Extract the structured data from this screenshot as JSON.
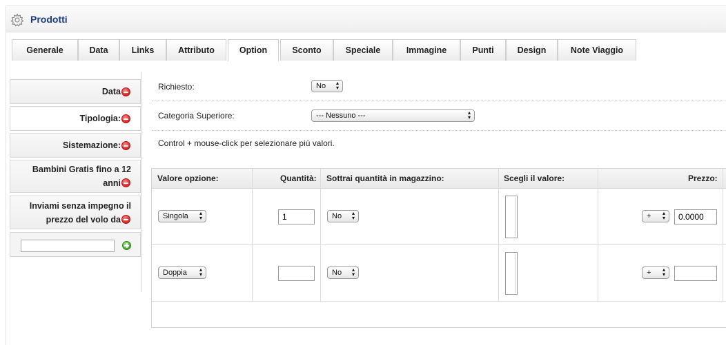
{
  "header": {
    "title": "Prodotti",
    "icon": "gear-icon"
  },
  "tabs": [
    {
      "label": "Generale"
    },
    {
      "label": "Data"
    },
    {
      "label": "Links"
    },
    {
      "label": "Attributo"
    },
    {
      "label": "Option"
    },
    {
      "label": "Sconto"
    },
    {
      "label": "Speciale"
    },
    {
      "label": "Immagine"
    },
    {
      "label": "Punti"
    },
    {
      "label": "Design"
    },
    {
      "label": "Note Viaggio"
    }
  ],
  "active_tab": "Option",
  "sidebar": {
    "items": [
      {
        "label": "Data"
      },
      {
        "label": "Tipologia:"
      },
      {
        "label": "Sistemazione:"
      },
      {
        "label_line1": "Bambini Gratis fino a 12",
        "label_line2": "anni"
      },
      {
        "label_line1": "Inviami senza impegno il",
        "label_line2": "prezzo del volo da"
      }
    ],
    "new_option_value": ""
  },
  "form": {
    "required_label": "Richiesto:",
    "required_value": "No",
    "parent_label": "Categoria Superiore:",
    "parent_value": "--- Nessuno ---",
    "hint": "Control + mouse-click per selezionare più valori."
  },
  "table": {
    "headers": {
      "value": "Valore opzione:",
      "quantity": "Quantità:",
      "subtract": "Sottrai quantità in magazzino:",
      "choose": "Scegli il valore:",
      "price": "Prezzo:"
    },
    "rows": [
      {
        "option": "Singola",
        "quantity": "1",
        "subtract": "No",
        "price_prefix": "+",
        "price": "0.0000"
      },
      {
        "option": "Doppia",
        "quantity": "",
        "subtract": "No",
        "price_prefix": "+",
        "price": ""
      }
    ]
  },
  "colors": {
    "title": "#1d3e84",
    "remove": "#d92020",
    "add": "#3ea52a"
  }
}
